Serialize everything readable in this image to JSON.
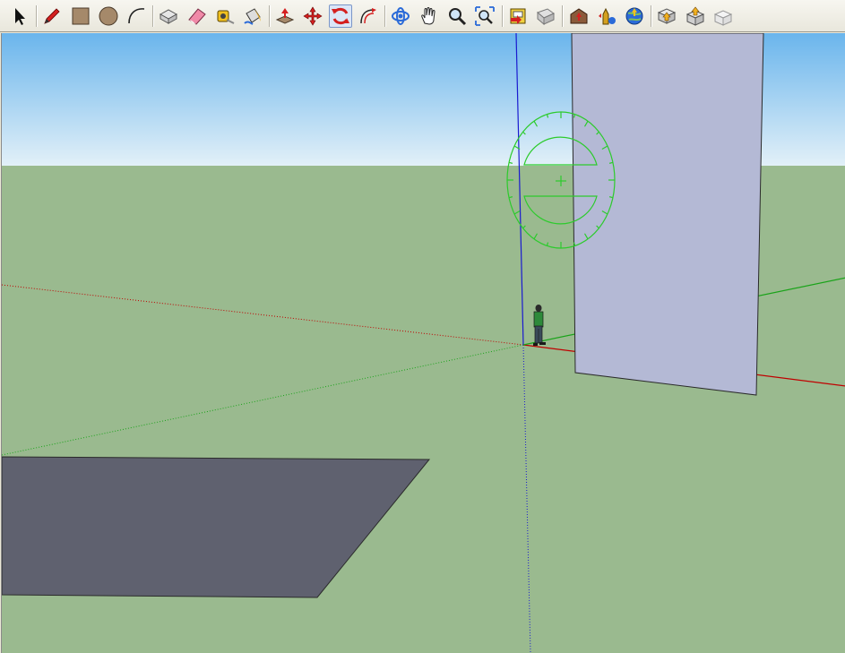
{
  "toolbar": {
    "tools": [
      {
        "name": "select-tool",
        "icon": "arrow-cursor-icon"
      },
      {
        "name": "line-tool",
        "icon": "pencil-icon"
      },
      {
        "name": "rectangle-tool",
        "icon": "rectangle-icon"
      },
      {
        "name": "circle-tool",
        "icon": "circle-icon"
      },
      {
        "name": "arc-tool",
        "icon": "arc-icon"
      },
      {
        "name": "make-component-tool",
        "icon": "component-icon"
      },
      {
        "name": "eraser-tool",
        "icon": "eraser-icon"
      },
      {
        "name": "tape-measure-tool",
        "icon": "tape-measure-icon"
      },
      {
        "name": "paint-bucket-tool",
        "icon": "paint-bucket-icon"
      },
      {
        "name": "push-pull-tool",
        "icon": "push-pull-icon"
      },
      {
        "name": "move-tool",
        "icon": "move-icon"
      },
      {
        "name": "rotate-tool",
        "icon": "rotate-icon"
      },
      {
        "name": "offset-tool",
        "icon": "offset-icon"
      },
      {
        "name": "orbit-tool",
        "icon": "orbit-icon"
      },
      {
        "name": "pan-tool",
        "icon": "hand-icon"
      },
      {
        "name": "zoom-tool",
        "icon": "magnifier-icon"
      },
      {
        "name": "zoom-extents-tool",
        "icon": "zoom-extents-icon"
      },
      {
        "name": "previous-view-tool",
        "icon": "previous-view-icon"
      },
      {
        "name": "next-view-tool",
        "icon": "next-view-icon"
      },
      {
        "name": "get-models-tool",
        "icon": "warehouse-icon"
      },
      {
        "name": "share-model-tool",
        "icon": "share-model-icon"
      },
      {
        "name": "google-earth-tool",
        "icon": "globe-icon"
      },
      {
        "name": "get-components-tool",
        "icon": "download-component-icon"
      },
      {
        "name": "share-component-tool",
        "icon": "upload-component-icon"
      },
      {
        "name": "extension-warehouse-tool",
        "icon": "extension-icon"
      }
    ],
    "active_tool": "rotate-tool"
  },
  "scene": {
    "sky_color": "#8ec8f2",
    "ground_color": "#9aba8f",
    "wall_color": "#b4b9d5",
    "floor_shape_color": "#5f616f",
    "protractor_color": "#2ccb2c",
    "axis_red": "#c00000",
    "axis_green": "#1aa31a",
    "axis_blue": "#1a1ad0"
  }
}
